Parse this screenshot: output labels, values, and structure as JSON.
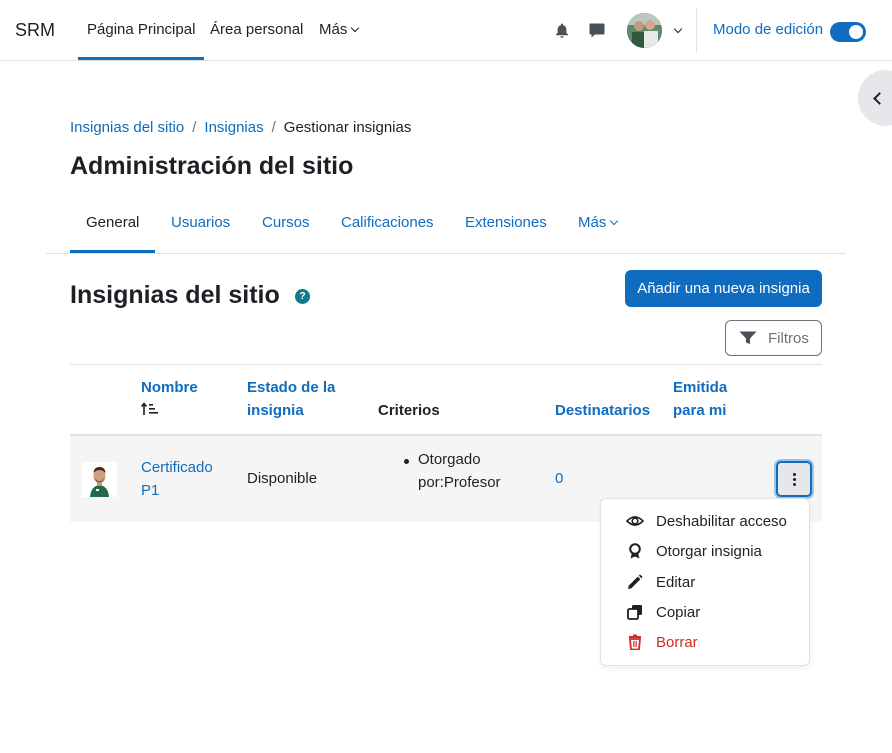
{
  "navbar": {
    "brand": "SRM",
    "items": [
      {
        "label": "Página Principal"
      },
      {
        "label": "Área personal"
      },
      {
        "label": "Más"
      }
    ],
    "edit_mode_label": "Modo de edición",
    "edit_mode_on": true
  },
  "breadcrumb": [
    "Insignias del sitio",
    "Insignias",
    "Gestionar insignias"
  ],
  "page_title": "Administración del sitio",
  "secondary_nav": [
    "General",
    "Usuarios",
    "Cursos",
    "Calificaciones",
    "Extensiones",
    "Más"
  ],
  "section_title": "Insignias del sitio",
  "help_icon_glyph": "?",
  "add_button_label": "Añadir una nueva insignia",
  "filter_button_label": "Filtros",
  "table": {
    "headers": {
      "name": "Nombre",
      "status_1": "Estado de la",
      "status_2": "insignia",
      "criteria": "Criterios",
      "recipients": "Destinatarios",
      "issued_1": "Emitida",
      "issued_2": "para mi"
    },
    "rows": [
      {
        "name_1": "Certificado",
        "name_2": "P1",
        "status": "Disponible",
        "criteria_1": "Otorgado",
        "criteria_2": "por:Profesor",
        "recipients": "0"
      }
    ]
  },
  "action_menu": [
    {
      "label": "Deshabilitar acceso",
      "icon": "eye-icon"
    },
    {
      "label": "Otorgar insignia",
      "icon": "award-icon"
    },
    {
      "label": "Editar",
      "icon": "pencil-icon"
    },
    {
      "label": "Copiar",
      "icon": "copy-icon"
    },
    {
      "label": "Borrar",
      "icon": "trash-icon"
    }
  ],
  "colors": {
    "primary": "#0f6cbf",
    "danger": "#ca3120",
    "text": "#1d2125"
  }
}
